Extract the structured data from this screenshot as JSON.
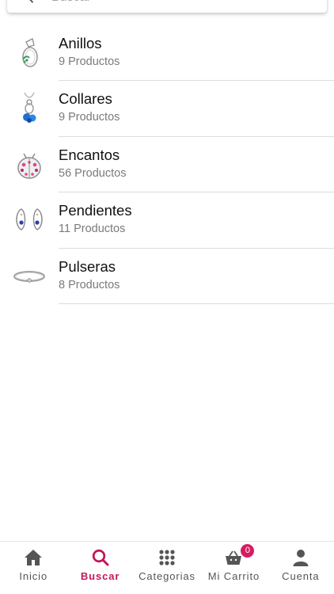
{
  "search": {
    "placeholder": "Buscar",
    "icon": "search-icon"
  },
  "categories": [
    {
      "name": "Anillos",
      "count": "9 Productos",
      "thumb": "ring-thumbnail"
    },
    {
      "name": "Collares",
      "count": "9 Productos",
      "thumb": "necklace-thumbnail"
    },
    {
      "name": "Encantos",
      "count": "56 Productos",
      "thumb": "charm-thumbnail"
    },
    {
      "name": "Pendientes",
      "count": "11 Productos",
      "thumb": "earrings-thumbnail"
    },
    {
      "name": "Pulseras",
      "count": "8 Productos",
      "thumb": "bracelet-thumbnail"
    }
  ],
  "bottom_nav": {
    "items": [
      {
        "label": "Inicio",
        "icon": "home-icon"
      },
      {
        "label": "Buscar",
        "icon": "search-icon",
        "active": true
      },
      {
        "label": "Categorias",
        "icon": "grid-icon"
      },
      {
        "label": "Mi Carrito",
        "icon": "basket-icon",
        "badge": "0"
      },
      {
        "label": "Cuenta",
        "icon": "user-icon"
      }
    ]
  },
  "colors": {
    "accent": "#c2185b",
    "badge": "#d81b60",
    "divider": "#dcdcdc",
    "secondary_text": "#7a7a7a"
  }
}
